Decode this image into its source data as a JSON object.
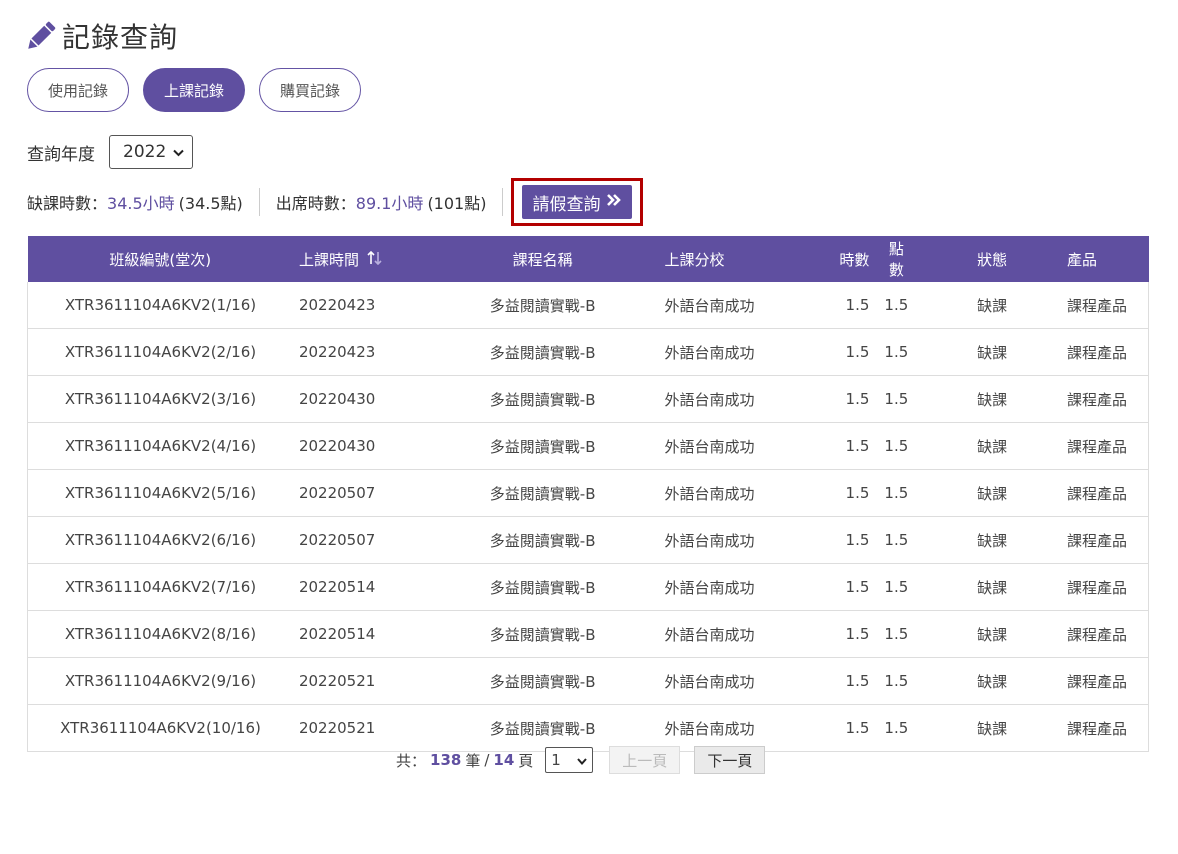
{
  "page": {
    "title": "記錄查詢",
    "title_icon": "pencil-icon",
    "accent": "#5f4fa0",
    "highlight": "#b30000"
  },
  "tabs": [
    {
      "label": "使用記錄",
      "active": false
    },
    {
      "label": "上課記錄",
      "active": true
    },
    {
      "label": "購買記錄",
      "active": false
    }
  ],
  "year_filter": {
    "label": "查詢年度",
    "value": "2022"
  },
  "stats": {
    "absent_label": "缺課時數：",
    "absent_hours": "34.5小時",
    "absent_points": "(34.5點)",
    "attend_label": "出席時數：",
    "attend_hours": "89.1小時",
    "attend_points": "(101點)"
  },
  "leave_button": {
    "label": "請假查詢",
    "icon": "double-chevron-right-icon"
  },
  "table": {
    "headers": [
      "班級編號(堂次)",
      "上課時間",
      "課程名稱",
      "上課分校",
      "時數",
      "點數",
      "狀態",
      "產品"
    ],
    "sort_icon": "sort-icon",
    "rows": [
      [
        "XTR3611104A6KV2(1/16)",
        "20220423",
        "多益閱讀實戰-B",
        "外語台南成功",
        "1.5",
        "1.5",
        "缺課",
        "課程產品"
      ],
      [
        "XTR3611104A6KV2(2/16)",
        "20220423",
        "多益閱讀實戰-B",
        "外語台南成功",
        "1.5",
        "1.5",
        "缺課",
        "課程產品"
      ],
      [
        "XTR3611104A6KV2(3/16)",
        "20220430",
        "多益閱讀實戰-B",
        "外語台南成功",
        "1.5",
        "1.5",
        "缺課",
        "課程產品"
      ],
      [
        "XTR3611104A6KV2(4/16)",
        "20220430",
        "多益閱讀實戰-B",
        "外語台南成功",
        "1.5",
        "1.5",
        "缺課",
        "課程產品"
      ],
      [
        "XTR3611104A6KV2(5/16)",
        "20220507",
        "多益閱讀實戰-B",
        "外語台南成功",
        "1.5",
        "1.5",
        "缺課",
        "課程產品"
      ],
      [
        "XTR3611104A6KV2(6/16)",
        "20220507",
        "多益閱讀實戰-B",
        "外語台南成功",
        "1.5",
        "1.5",
        "缺課",
        "課程產品"
      ],
      [
        "XTR3611104A6KV2(7/16)",
        "20220514",
        "多益閱讀實戰-B",
        "外語台南成功",
        "1.5",
        "1.5",
        "缺課",
        "課程產品"
      ],
      [
        "XTR3611104A6KV2(8/16)",
        "20220514",
        "多益閱讀實戰-B",
        "外語台南成功",
        "1.5",
        "1.5",
        "缺課",
        "課程產品"
      ],
      [
        "XTR3611104A6KV2(9/16)",
        "20220521",
        "多益閱讀實戰-B",
        "外語台南成功",
        "1.5",
        "1.5",
        "缺課",
        "課程產品"
      ],
      [
        "XTR3611104A6KV2(10/16)",
        "20220521",
        "多益閱讀實戰-B",
        "外語台南成功",
        "1.5",
        "1.5",
        "缺課",
        "課程產品"
      ]
    ]
  },
  "pagination": {
    "total_prefix": "共：",
    "total_records": "138",
    "records_unit": "筆",
    "slash": "/",
    "total_pages": "14",
    "pages_unit": "頁",
    "current_page": "1",
    "prev_label": "上一頁",
    "next_label": "下一頁"
  }
}
